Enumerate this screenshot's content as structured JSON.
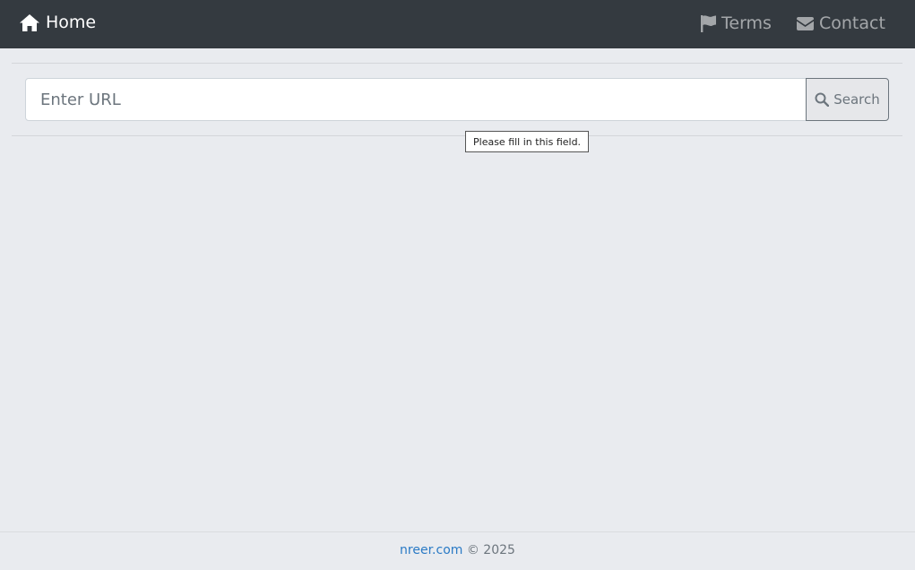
{
  "navbar": {
    "brand_label": "Home",
    "brand_icon": "home-icon",
    "links": [
      {
        "label": "Terms",
        "icon": "flag-icon"
      },
      {
        "label": "Contact",
        "icon": "envelope-icon"
      }
    ]
  },
  "search": {
    "placeholder": "Enter URL",
    "value": "",
    "button_label": "Search",
    "button_icon": "search-icon"
  },
  "tooltip": {
    "text": "Please fill in this field."
  },
  "footer": {
    "link_label": "nreer.com",
    "copyright": "© 2025"
  },
  "colors": {
    "navbar_bg": "#343a40",
    "page_bg": "#e9ebef",
    "link_blue": "#2a7ac5"
  }
}
